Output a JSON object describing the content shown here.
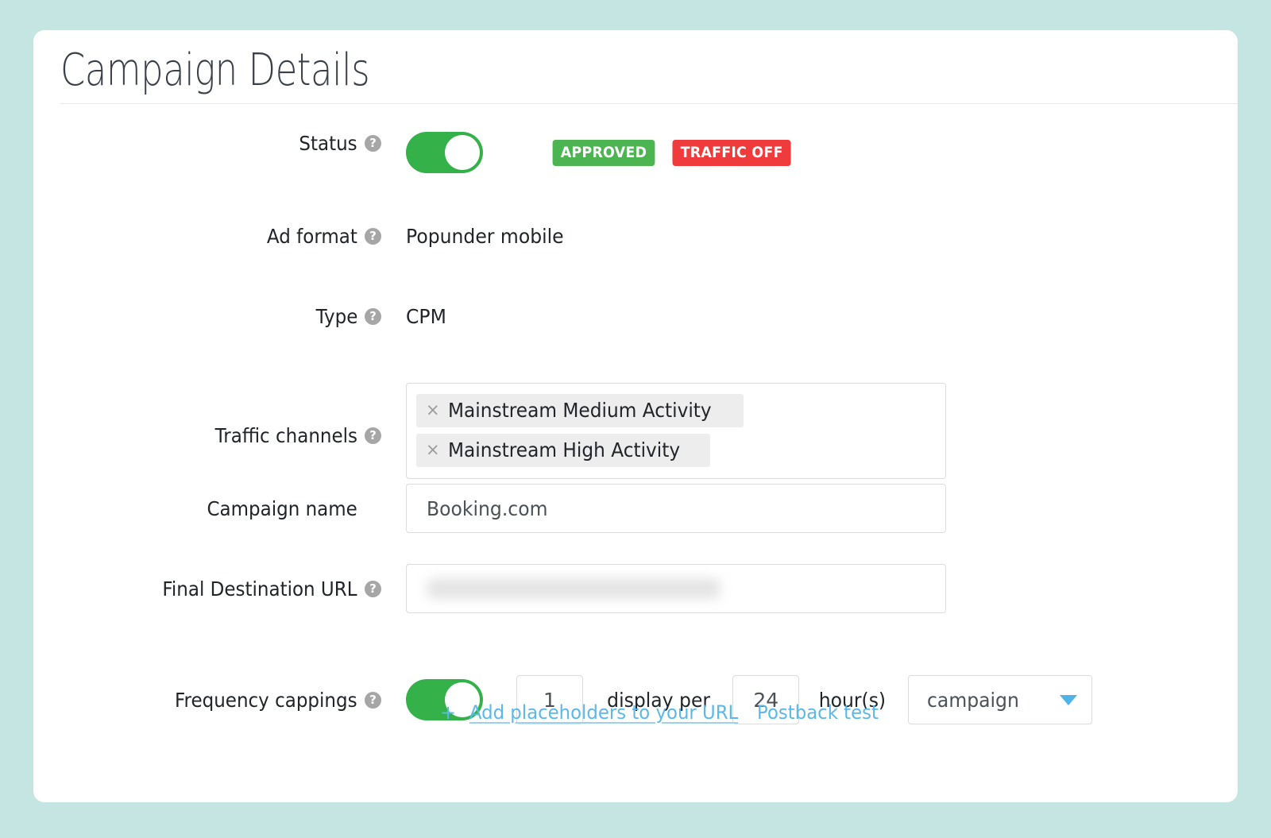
{
  "page": {
    "background_color": "#c4e5e2",
    "card_background": "#ffffff",
    "title": "Campaign Details"
  },
  "form": {
    "status": {
      "label": "Status",
      "help_icon": "question-mark-icon",
      "toggle_state": "on",
      "badges": [
        {
          "text": "APPROVED",
          "color": "#4cb551"
        },
        {
          "text": "TRAFFIC OFF",
          "color": "#ef3b3b"
        }
      ]
    },
    "ad_format": {
      "label": "Ad format",
      "help_icon": "question-mark-icon",
      "value": "Popunder mobile"
    },
    "type": {
      "label": "Type",
      "help_icon": "question-mark-icon",
      "value": "CPM"
    },
    "traffic_channels": {
      "label": "Traffic channels",
      "help_icon": "question-mark-icon",
      "tags": [
        {
          "remove_icon": "×",
          "label": "Mainstream Medium Activity"
        },
        {
          "remove_icon": "×",
          "label": "Mainstream High Activity"
        }
      ]
    },
    "campaign_name": {
      "label": "Campaign name",
      "value": "Booking.com",
      "placeholder": "Campaign name"
    },
    "final_destination_url": {
      "label": "Final Destination URL",
      "help_icon": "question-mark-icon",
      "value": "",
      "value_hidden": true,
      "links": {
        "plus": "+",
        "add_placeholders": "Add placeholders to your URL",
        "postback_test": "Postback test",
        "color": "#5bb8e8"
      }
    },
    "frequency_cappings": {
      "label": "Frequency cappings",
      "help_icon": "question-mark-icon",
      "toggle_state": "on",
      "display_count": "1",
      "middle_text": "display per",
      "hours_count": "24",
      "hours_text": "hour(s)",
      "scope_selected": "campaign",
      "scope_caret": "chevron-down-icon"
    }
  }
}
